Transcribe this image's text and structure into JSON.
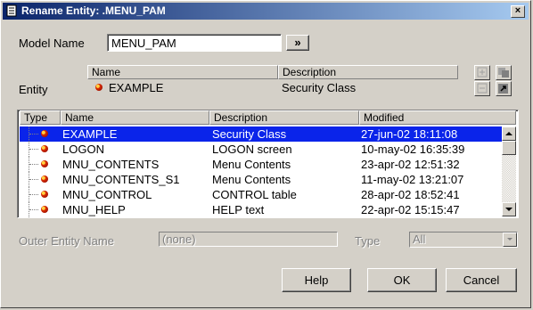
{
  "window": {
    "title": "Rename Entity: .MENU_PAM",
    "close_label": "×"
  },
  "model": {
    "label": "Model Name",
    "value": "MENU_PAM",
    "browse_label": "»"
  },
  "entity": {
    "label": "Entity",
    "columns": [
      "Name",
      "Description"
    ],
    "row": {
      "name": "EXAMPLE",
      "description": "Security Class"
    }
  },
  "list": {
    "columns": [
      "Type",
      "Name",
      "Description",
      "Modified"
    ],
    "rows": [
      {
        "name": "EXAMPLE",
        "description": "Security Class",
        "modified": "27-jun-02 18:11:08",
        "selected": true
      },
      {
        "name": "LOGON",
        "description": "LOGON screen",
        "modified": "10-may-02 16:35:39"
      },
      {
        "name": "MNU_CONTENTS",
        "description": "Menu Contents",
        "modified": "23-apr-02 12:51:32"
      },
      {
        "name": "MNU_CONTENTS_S1",
        "description": "Menu Contents",
        "modified": "11-may-02 13:21:07"
      },
      {
        "name": "MNU_CONTROL",
        "description": "CONTROL table",
        "modified": "28-apr-02 18:52:41"
      },
      {
        "name": "MNU_HELP",
        "description": "HELP text",
        "modified": "22-apr-02 15:15:47"
      }
    ]
  },
  "outer": {
    "label": "Outer Entity Name",
    "value": "(none)",
    "type_label": "Type",
    "type_value": "All"
  },
  "buttons": {
    "help": "Help",
    "ok": "OK",
    "cancel": "Cancel"
  },
  "colors": {
    "selection": "#0a24ea",
    "selection_text": "#ffffff",
    "window_bg": "#d4d0c8"
  }
}
